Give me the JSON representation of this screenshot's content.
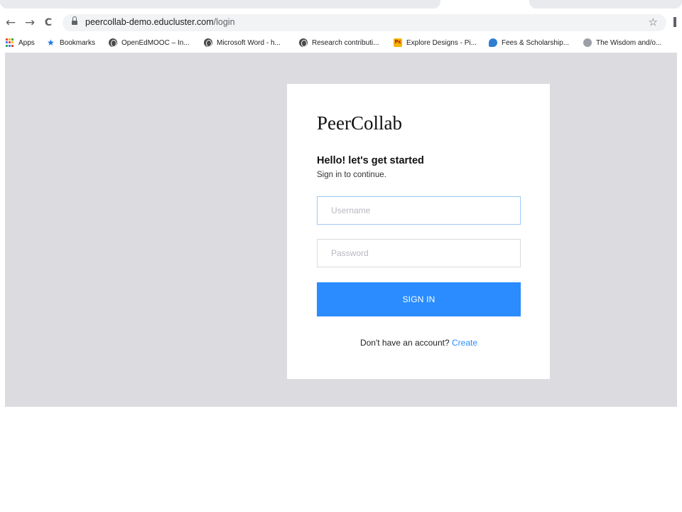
{
  "browser": {
    "url_host": "peercollab-demo.educluster.com",
    "url_path": "/login",
    "nav": {
      "back_icon": "←",
      "forward_icon": "→",
      "reload_icon": "C",
      "star_icon": "☆"
    },
    "bookmarks": [
      {
        "label": "Apps",
        "icon": "apps-grid-icon"
      },
      {
        "label": "Bookmarks",
        "icon": "star-icon"
      },
      {
        "label": "OpenEdMOOC – In...",
        "icon": "globe-icon"
      },
      {
        "label": "Microsoft Word - h...",
        "icon": "globe-icon"
      },
      {
        "label": "Research contributi...",
        "icon": "globe-icon"
      },
      {
        "label": "Explore Designs - Pi...",
        "icon": "pixabay-icon"
      },
      {
        "label": "Fees & Scholarship...",
        "icon": "chat-bubble-icon"
      },
      {
        "label": "The Wisdom and/o...",
        "icon": "face-icon"
      }
    ],
    "bookmark_icon_text": {
      "px": "Px",
      "star": "★"
    }
  },
  "login": {
    "brand": "PeerCollab",
    "greeting": "Hello! let's get started",
    "subtitle": "Sign in to continue.",
    "username_placeholder": "Username",
    "password_placeholder": "Password",
    "signin_label": "SIGN IN",
    "no_account_text": "Don't have an account?",
    "create_link": "Create"
  },
  "colors": {
    "accent": "#2a8cff",
    "page_background": "#dcdce0",
    "card_background": "#ffffff"
  }
}
